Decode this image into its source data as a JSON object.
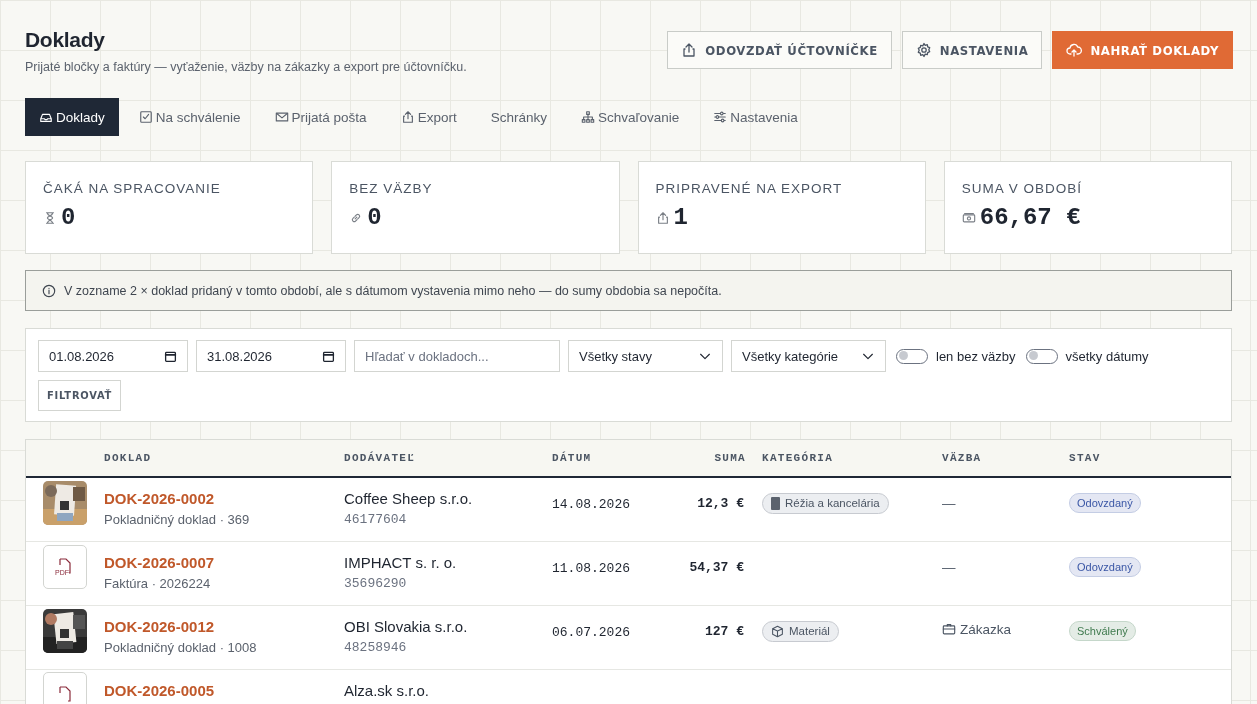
{
  "header": {
    "title": "Doklady",
    "subtitle": "Prijaté bločky a faktúry — vyťaženie, väzby na zákazky a export pre účtovníčku.",
    "buttons": [
      {
        "label": "ODOVZDAŤ ÚČTOVNÍČKE",
        "kind": "secondary"
      },
      {
        "label": "NASTAVENIA",
        "kind": "secondary"
      },
      {
        "label": "NAHRAŤ DOKLADY",
        "kind": "primary"
      }
    ]
  },
  "tabs": [
    {
      "label": "Doklady",
      "selected": true
    },
    {
      "label": "Na schválenie",
      "selected": false
    },
    {
      "label": "Prijatá pošta",
      "selected": false
    },
    {
      "label": "Export",
      "selected": false
    },
    {
      "label": "Schránky",
      "selected": false
    },
    {
      "label": "Schvaľovanie",
      "selected": false
    },
    {
      "label": "Nastavenia",
      "selected": false
    }
  ],
  "stats": [
    {
      "label": "ČAKÁ NA SPRACOVANIE",
      "value": "0"
    },
    {
      "label": "BEZ VÄZBY",
      "value": "0"
    },
    {
      "label": "PRIPRAVENÉ NA EXPORT",
      "value": "1"
    },
    {
      "label": "SUMA V OBDOBÍ",
      "value": "66,67 €"
    }
  ],
  "notice": "V zozname 2 × doklad pridaný v tomto období, ale s dátumom vystavenia mimo neho — do sumy obdobia sa nepočíta.",
  "filters": {
    "date_from": "01.08.2026",
    "date_to": "31.08.2026",
    "search": {
      "placeholder": "Hľadať v dokladoch..."
    },
    "selects": [
      "Všetky stavy",
      "Všetky kategórie"
    ],
    "toggles": [
      {
        "label": "len bez väzby",
        "on": false
      },
      {
        "label": "všetky dátumy",
        "on": false
      }
    ],
    "button": "FILTROVAŤ"
  },
  "table": {
    "columns": [
      "DOKLAD",
      "DODÁVATEĽ",
      "DÁTUM",
      "SUMA",
      "KATEGÓRIA",
      "VÄZBA",
      "STAV"
    ],
    "rows": [
      {
        "number": "DOK-2026-0002",
        "type": "Pokladničný doklad · 369",
        "supplier": "Coffee Sheep s.r.o.",
        "ico": "46177604",
        "date": "14.08.2026",
        "sum": "12,3 €",
        "category": {
          "label": "Réžia a kancelária",
          "kind": "office"
        },
        "link": {
          "label": "—",
          "kind": "none"
        },
        "status": {
          "label": "Odovzdaný",
          "color": "#3b57a6"
        }
      },
      {
        "thumb": {
          "kind": "pdf",
          "label": "PDF"
        },
        "number": "DOK-2026-0007",
        "type": "Faktúra · 2026224",
        "supplier": "IMPHACT s. r. o.",
        "ico": "35696290",
        "date": "11.08.2026",
        "sum": "54,37 €",
        "link": {
          "label": "—",
          "kind": "none"
        },
        "status": {
          "label": "Odovzdaný",
          "color": "#3b57a6"
        }
      },
      {
        "number": "DOK-2026-0012",
        "type": "Pokladničný doklad · 1008",
        "supplier": "OBI Slovakia s.r.o.",
        "ico": "48258946",
        "date": "06.07.2026",
        "sum": "127 €",
        "category": {
          "label": "Materiál",
          "kind": "material"
        },
        "link": {
          "label": "Zákazka",
          "kind": "order"
        },
        "status": {
          "label": "Schválený",
          "color": "#3f7a4e"
        }
      },
      {
        "thumb": {
          "kind": "pdf"
        },
        "number": "DOK-2026-0005",
        "supplier": "Alza.sk s.r.o."
      }
    ]
  }
}
